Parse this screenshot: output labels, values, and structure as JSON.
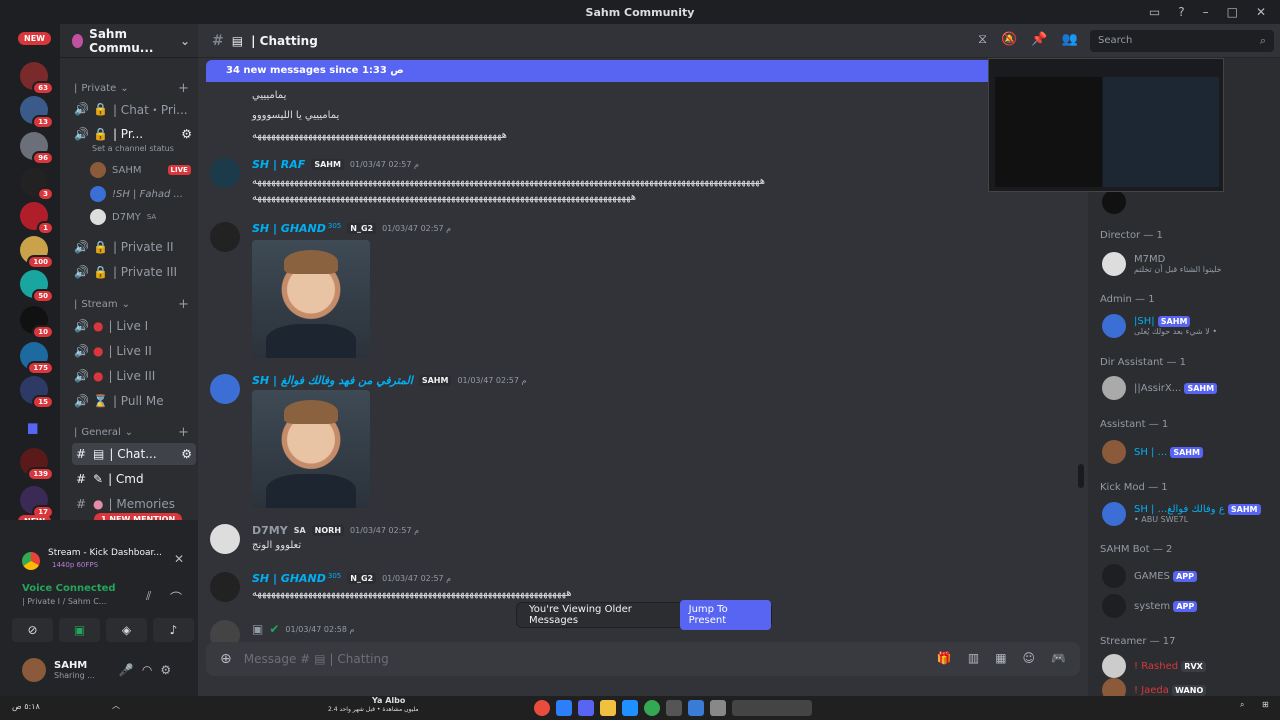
{
  "window": {
    "title": "Sahm Community"
  },
  "servers": [
    {
      "new": "NEW"
    },
    {
      "badge": "63"
    },
    {
      "badge": "13"
    },
    {
      "badge": "96"
    },
    {
      "badge": "3"
    },
    {
      "badge": "1"
    },
    {
      "badge": "100"
    },
    {
      "badge": "50"
    },
    {
      "badge": "10"
    },
    {
      "badge": "175"
    },
    {
      "badge": "15"
    },
    {
      "badge": "139"
    },
    {
      "badge": "17"
    },
    {
      "new": "NEW"
    }
  ],
  "guild": {
    "name": "Sahm Commu..."
  },
  "sidebar": {
    "categories": {
      "private": "Private",
      "stream": "Stream",
      "general": "General"
    },
    "channels": {
      "chat_pri": "| Chat・Pri...",
      "pr": "| Pr...",
      "pr_status": "Set a channel status",
      "private_ii": "| Private II",
      "private_iii": "| Private III",
      "live_i": "| Live I",
      "live_ii": "| Live II",
      "live_iii": "| Live III",
      "pull_me": "| Pull Me",
      "chatting": "| Chat...",
      "cmd": "| Cmd",
      "memories": "| Memories"
    },
    "voice_users": [
      {
        "name": "SAHM",
        "live": "LIVE"
      },
      {
        "name": "!SH | Fahad ..."
      },
      {
        "name": "D7MY",
        "tag": "SA"
      }
    ],
    "new_mention": "1 NEW MENTION"
  },
  "stream_panel": {
    "title": "Stream - Kick Dashboar...",
    "quality": "1440p 60FPS"
  },
  "voice_panel": {
    "status": "Voice Connected",
    "channel": "| Private I / Sahm C..."
  },
  "user_panel": {
    "name": "SAHM",
    "status": "Sharing ..."
  },
  "channel_header": {
    "name": "| Chatting",
    "search_placeholder": "Search"
  },
  "new_messages_bar": {
    "text": "34 new messages since 1:33 ص",
    "mark": "M"
  },
  "messages": [
    {
      "lines": [
        "يماميييي",
        "يماميييي يا الليسوووو",
        "ههههههههههههههههههههههههههههههههههههههههههههههههههههههه"
      ]
    },
    {
      "author": "SH | RAF",
      "tag": "SAHM",
      "time": "01/03/47 02:57 م",
      "lines": [
        "ههههههههههههههههههههههههههههههههههههههههههههههههههههههههههههههههههههههههههههههههههههههههههههههههههههههههههههههه",
        "ههههههههههههههههههههههههههههههههههههههههههههههههههههههههههههههههههههههههههههههههههه"
      ]
    },
    {
      "author": "SH | GHAND",
      "sup": "305",
      "tag": "N_G2",
      "time": "01/03/47 02:57 م"
    },
    {
      "author": "SH | المترفي من فهد وفالك فوالغ",
      "tag": "SAHM",
      "time": "01/03/47 02:57 م"
    },
    {
      "author": "D7MY",
      "tag": "SA",
      "tag2": "NORH",
      "time": "01/03/47 02:57 م",
      "lines": [
        "تعلووو الونج"
      ]
    },
    {
      "author": "SH | GHAND",
      "sup": "305",
      "tag": "N_G2",
      "time": "01/03/47 02:57 م",
      "lines": [
        "ههههههههههههههههههههههههههههههههههههههههههههههههههههههههههههههههههههه"
      ]
    },
    {
      "time": "01/03/47 02:58 م"
    }
  ],
  "jump_bar": {
    "text": "You're Viewing Older Messages",
    "button": "Jump To Present"
  },
  "composer": {
    "placeholder": "Message #",
    "channel": "| Chatting"
  },
  "members": {
    "roles": [
      {
        "name": "Director — 1"
      },
      {
        "name": "Admin — 1"
      },
      {
        "name": "Dir Assistant — 1"
      },
      {
        "name": "Assistant — 1"
      },
      {
        "name": "Kick Mod — 1"
      },
      {
        "name": "SAHM Bot — 2"
      },
      {
        "name": "Streamer — 17"
      }
    ],
    "list": [
      {
        "name": "M7MD",
        "sub": "خليتوا الشتاء قبل أن تخلتم"
      },
      {
        "name": "|SH|",
        "chip": "SAHM",
        "sub": "لا شيء بعد حولك يُغلى •"
      },
      {
        "name": "||AssirX...",
        "chip": "SAHM"
      },
      {
        "name": "SH | ...",
        "chip": "SAHM"
      },
      {
        "name": "SH | ...ع وفالك فوالغ",
        "chip": "SAHM",
        "sub": "• ABU SWE7L"
      },
      {
        "name": "GAMES",
        "chip": "APP"
      },
      {
        "name": "system",
        "chip": "APP"
      },
      {
        "name": "! Rashed",
        "chip": "RVX"
      },
      {
        "name": "! Jaeda",
        "chip": "WANO"
      }
    ]
  },
  "taskbar": {
    "media_title": "Ya Albo",
    "media_sub": "2.4 مليون مشاهدة • قبل شهر واحد",
    "time": "٥:١٨ ص"
  }
}
